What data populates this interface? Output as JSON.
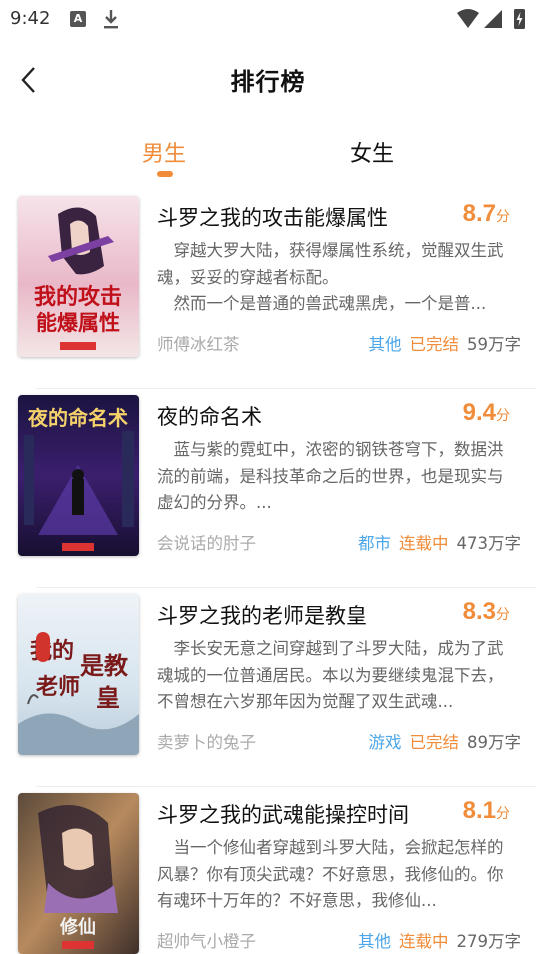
{
  "status_bar": {
    "time": "9:42",
    "icons": [
      "a-notification-icon",
      "download-icon",
      "wifi-icon",
      "signal-icon",
      "battery-charging-icon"
    ]
  },
  "header": {
    "back_icon": "chevron-left-icon",
    "title": "排行榜"
  },
  "tabs": [
    {
      "label": "男生",
      "active": true
    },
    {
      "label": "女生",
      "active": false
    }
  ],
  "colors": {
    "accent": "#f08c3a",
    "genre": "#4da6e8",
    "author": "#aaaaaa",
    "desc": "#666666"
  },
  "books": [
    {
      "cover_text": "我的攻击能爆属性",
      "title": "斗罗之我的攻击能爆属性",
      "score": "8.7",
      "score_unit": "分",
      "desc_1": "穿越大罗大陆，获得爆属性系统，觉醒双生武魂，妥妥的穿越者标配。",
      "desc_2": "然而一个是普通的兽武魂黑虎，一个是普...",
      "author": "师傅冰红茶",
      "genre": "其他",
      "status": "已完结",
      "words": "59万字"
    },
    {
      "cover_text": "夜的命名术",
      "title": "夜的命名术",
      "score": "9.4",
      "score_unit": "分",
      "desc_1": "蓝与紫的霓虹中，浓密的钢铁苍穹下，数据洪流的前端，是科技革命之后的世界，也是现实与虚幻的分界。...",
      "desc_2": "",
      "author": "会说话的肘子",
      "genre": "都市",
      "status": "连载中",
      "words": "473万字"
    },
    {
      "cover_text": "我的老师是教皇",
      "title": "斗罗之我的老师是教皇",
      "score": "8.3",
      "score_unit": "分",
      "desc_1": "李长安无意之间穿越到了斗罗大陆，成为了武魂城的一位普通居民。本以为要继续鬼混下去，不曾想在六岁那年因为觉醒了双生武魂...",
      "desc_2": "",
      "author": "卖萝卜的兔子",
      "genre": "游戏",
      "status": "已完结",
      "words": "89万字"
    },
    {
      "cover_text": "修仙",
      "title": "斗罗之我的武魂能操控时间",
      "score": "8.1",
      "score_unit": "分",
      "desc_1": "当一个修仙者穿越到斗罗大陆，会掀起怎样的风暴？你有顶尖武魂？不好意思，我修仙的。你有魂环十万年的？不好意思，我修仙...",
      "desc_2": "",
      "author": "超帅气小橙子",
      "genre": "其他",
      "status": "连载中",
      "words": "279万字"
    }
  ]
}
